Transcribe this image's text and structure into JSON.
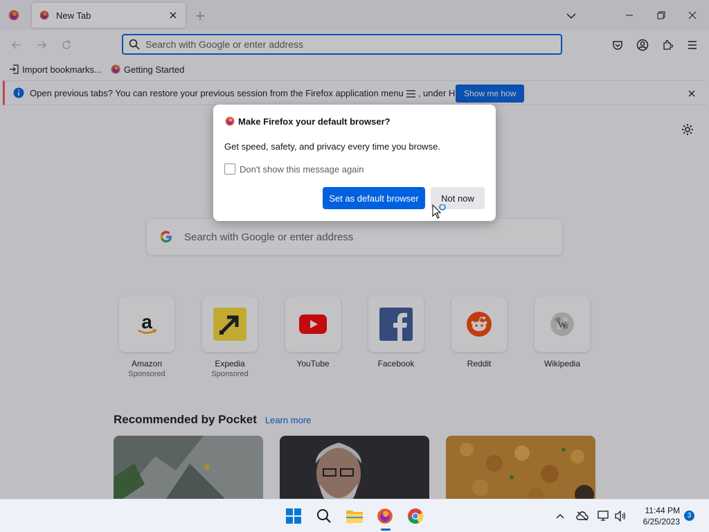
{
  "browser": {
    "tab": {
      "title": "New Tab"
    },
    "urlbar": {
      "placeholder": "Search with Google or enter address"
    },
    "bookmarks": [
      {
        "label": "Import bookmarks..."
      },
      {
        "label": "Getting Started"
      }
    ]
  },
  "notification": {
    "text_before": "Open previous tabs? You can restore your previous session from the Firefox application menu",
    "text_after": ", under History.",
    "button_label": "Show me how"
  },
  "newtab": {
    "search_placeholder": "Search with Google or enter address",
    "top_sites": [
      {
        "name": "Amazon",
        "sponsor": "Sponsored",
        "icon": "amazon-icon"
      },
      {
        "name": "Expedia",
        "sponsor": "Sponsored",
        "icon": "expedia-icon"
      },
      {
        "name": "YouTube",
        "sponsor": "",
        "icon": "youtube-icon"
      },
      {
        "name": "Facebook",
        "sponsor": "",
        "icon": "facebook-icon"
      },
      {
        "name": "Reddit",
        "sponsor": "",
        "icon": "reddit-icon"
      },
      {
        "name": "Wikipedia",
        "sponsor": "",
        "icon": "wikipedia-icon"
      }
    ],
    "pocket": {
      "title": "Recommended by Pocket",
      "learn_more": "Learn more"
    }
  },
  "dialog": {
    "title": "Make Firefox your default browser?",
    "body": "Get speed, safety, and privacy every time you browse.",
    "checkbox_label": "Don't show this message again",
    "checkbox_checked": false,
    "primary_button": "Set as default browser",
    "secondary_button": "Not now"
  },
  "taskbar": {
    "time": "11:44 PM",
    "date": "6/25/2023",
    "notification_count": "3",
    "apps": [
      "start-icon",
      "search-icon",
      "file-explorer-icon",
      "firefox-icon",
      "chrome-icon"
    ]
  },
  "colors": {
    "accent": "#0061e0",
    "notif_stripe": "#ff4f5e",
    "taskbar_accent": "#0067c0"
  }
}
